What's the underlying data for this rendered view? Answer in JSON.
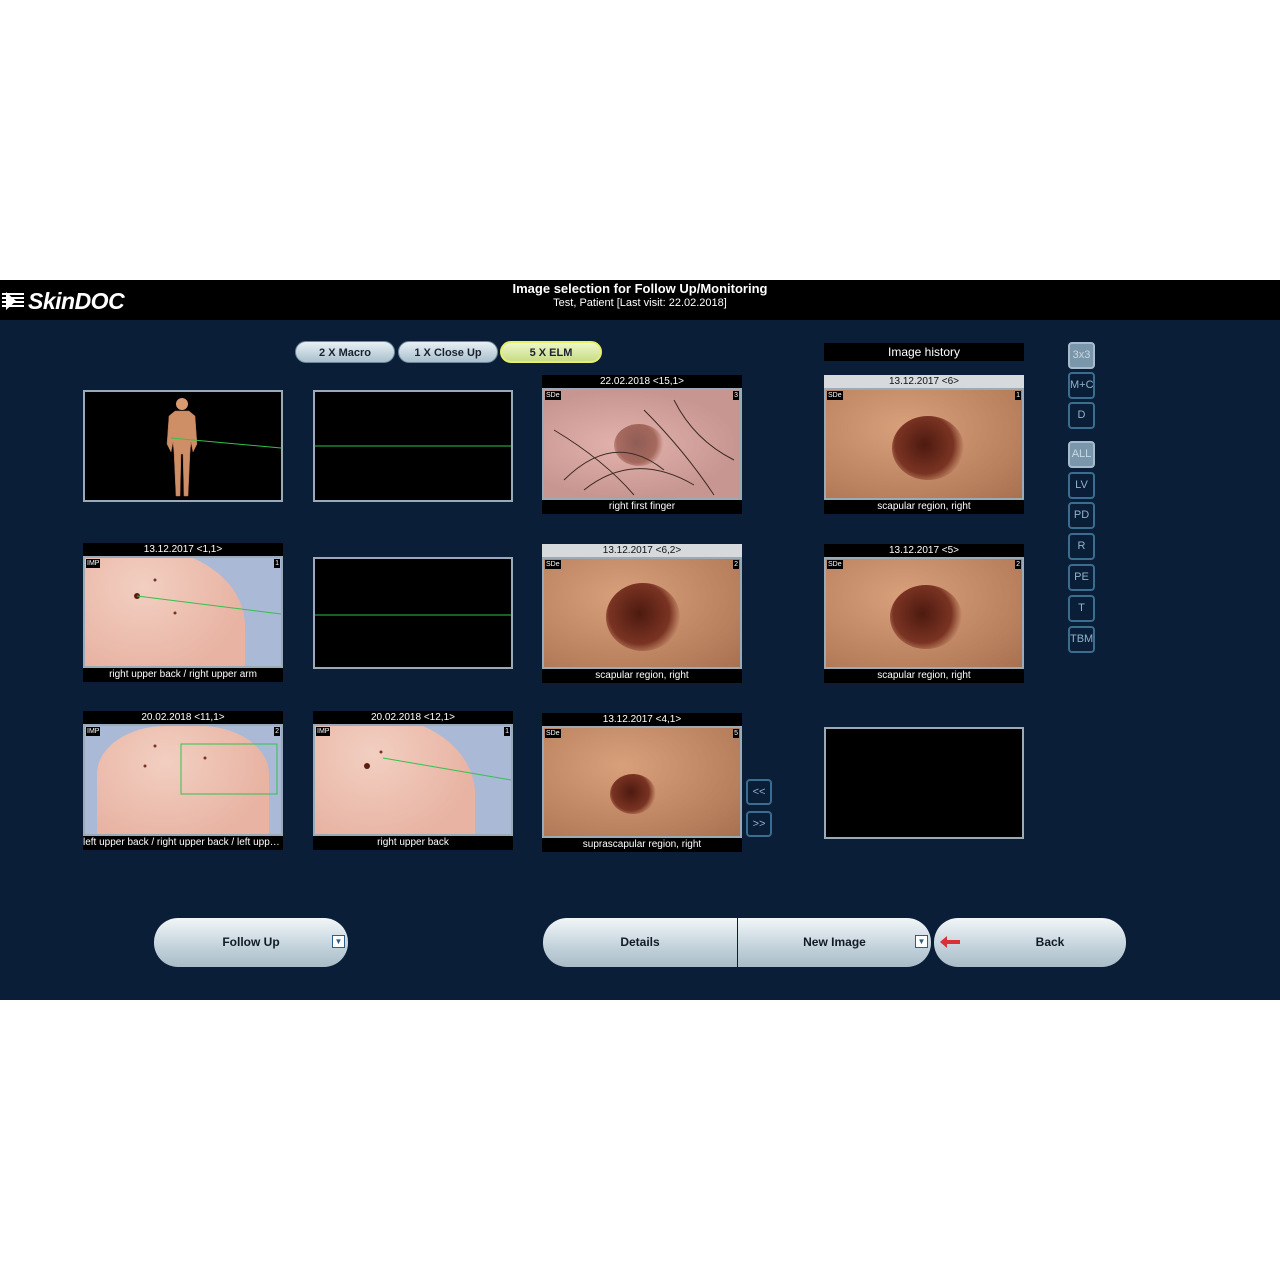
{
  "app": {
    "logo_text": "SkinDOC",
    "title": "Image selection for Follow Up/Monitoring",
    "subtitle": "Test, Patient [Last visit: 22.02.2018]"
  },
  "tabs": [
    {
      "label": "2 X Macro",
      "active": false
    },
    {
      "label": "1 X Close Up",
      "active": false
    },
    {
      "label": "5 X ELM",
      "active": true
    }
  ],
  "history_label": "Image history",
  "slots": {
    "body_map": {},
    "empty1": {},
    "elm_top": {
      "date": "22.02.2018 <15,1>",
      "badge_left": "SDe",
      "badge_right": "3",
      "caption": "right first finger"
    },
    "hist_top": {
      "date": "13.12.2017 <6>",
      "badge_left": "SDe",
      "badge_right": "1",
      "caption": "scapular region, right"
    },
    "closeup_mid": {
      "date": "13.12.2017 <1,1>",
      "badge_left": "IMP",
      "badge_right": "1",
      "caption": "right upper back / right upper arm"
    },
    "empty2": {},
    "elm_mid": {
      "date": "13.12.2017 <6,2>",
      "badge_left": "SDe",
      "badge_right": "2",
      "caption": "scapular region, right"
    },
    "hist_mid": {
      "date": "13.12.2017 <5>",
      "badge_left": "SDe",
      "badge_right": "2",
      "caption": "scapular region, right"
    },
    "macro_bot": {
      "date": "20.02.2018 <11,1>",
      "badge_left": "IMP",
      "badge_right": "2",
      "caption": "left upper back / right upper back / left upper..."
    },
    "closeup_bot": {
      "date": "20.02.2018 <12,1>",
      "badge_left": "IMP",
      "badge_right": "1",
      "caption": "right upper back"
    },
    "elm_bot": {
      "date": "13.12.2017 <4,1>",
      "badge_left": "SDe",
      "badge_right": "5",
      "caption": "suprascapular region, right"
    }
  },
  "nav": {
    "prev": "<<",
    "next": ">>"
  },
  "side_buttons": [
    {
      "label": "3x3",
      "active": true
    },
    {
      "label": "M+C",
      "active": false
    },
    {
      "label": "D",
      "active": false
    },
    {
      "label": "ALL",
      "active": true
    },
    {
      "label": "LV",
      "active": false
    },
    {
      "label": "PD",
      "active": false
    },
    {
      "label": "R",
      "active": false
    },
    {
      "label": "PE",
      "active": false
    },
    {
      "label": "T",
      "active": false
    },
    {
      "label": "TBM",
      "active": false
    }
  ],
  "bottom": {
    "follow_up": "Follow Up",
    "details": "Details",
    "new_image": "New Image",
    "back": "Back"
  },
  "colors": {
    "background": "#0b1e38",
    "active_tab": "#e6f06a",
    "link_line": "#31c24a"
  }
}
